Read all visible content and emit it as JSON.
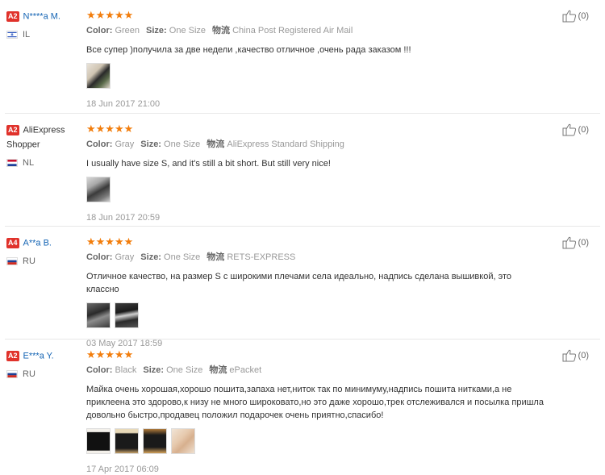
{
  "reviews": [
    {
      "badge": "A2",
      "name": "N****a M.",
      "country": "IL",
      "stars": "★★★★★",
      "color_label": "Color:",
      "color": "Green",
      "size_label": "Size:",
      "size": "One Size",
      "shipping_label": "物流",
      "shipping": "China Post Registered Air Mail",
      "text": "Все супер )получила за две недели ,качество отличное ,очень рада заказом !!!",
      "date": "18 Jun 2017 21:00",
      "helpful": "(0)"
    },
    {
      "badge": "A2",
      "name": "AliExpress Shopper",
      "country": "NL",
      "stars": "★★★★★",
      "color_label": "Color:",
      "color": "Gray",
      "size_label": "Size:",
      "size": "One Size",
      "shipping_label": "物流",
      "shipping": "AliExpress Standard Shipping",
      "text": "I usually have size S, and it's still a bit short. But still very nice!",
      "date": "18 Jun 2017 20:59",
      "helpful": "(0)"
    },
    {
      "badge": "A4",
      "name": "A**a B.",
      "country": "RU",
      "stars": "★★★★★",
      "color_label": "Color:",
      "color": "Gray",
      "size_label": "Size:",
      "size": "One Size",
      "shipping_label": "物流",
      "shipping": "RETS-EXPRESS",
      "text": "Отличное качество, на размер S с широкими плечами села идеально, надпись сделана вышивкой, это классно",
      "date": "03 May 2017 18:59",
      "helpful": "(0)"
    },
    {
      "badge": "A2",
      "name": "E***a Y.",
      "country": "RU",
      "stars": "★★★★★",
      "color_label": "Color:",
      "color": "Black",
      "size_label": "Size:",
      "size": "One Size",
      "shipping_label": "物流",
      "shipping": "ePacket",
      "text": "Майка очень хорошая,хорошо пошита,запаха нет,ниток так по минимуму,надпись пошита нитками,а не приклеена это здорово,к низу не много широковато,но это даже хорошо,трек отслеживался и посылка пришла довольно быстро,продавец положил подарочек очень приятно,спасибо!",
      "date": "17 Apr 2017 06:09",
      "helpful": "(0)"
    }
  ],
  "colors": {
    "star": "#f27d0c",
    "badge": "#e0322b",
    "name_link": "#1464b4"
  },
  "icons": {
    "helpful": "thumbs-up-icon"
  }
}
